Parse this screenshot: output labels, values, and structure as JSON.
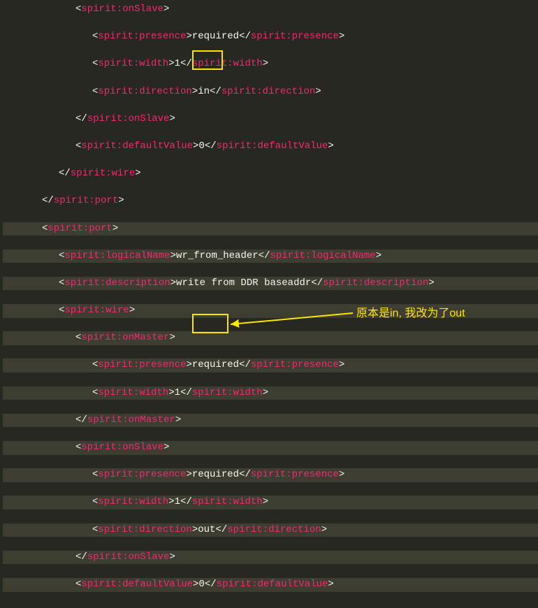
{
  "tag": {
    "onSlave": "spirit:onSlave",
    "presence": "spirit:presence",
    "width": "spirit:width",
    "direction": "spirit:direction",
    "defaultValue": "spirit:defaultValue",
    "wire": "spirit:wire",
    "port": "spirit:port",
    "logicalName": "spirit:logicalName",
    "description": "spirit:description",
    "onMaster": "spirit:onMaster"
  },
  "val": {
    "required": "required",
    "one": "1",
    "in": "in",
    "out": "out",
    "zero": "0",
    "logicalName": "wr_from_header",
    "description": "write from DDR baseaddr"
  },
  "annotation": "原本是in, 我改为了out"
}
